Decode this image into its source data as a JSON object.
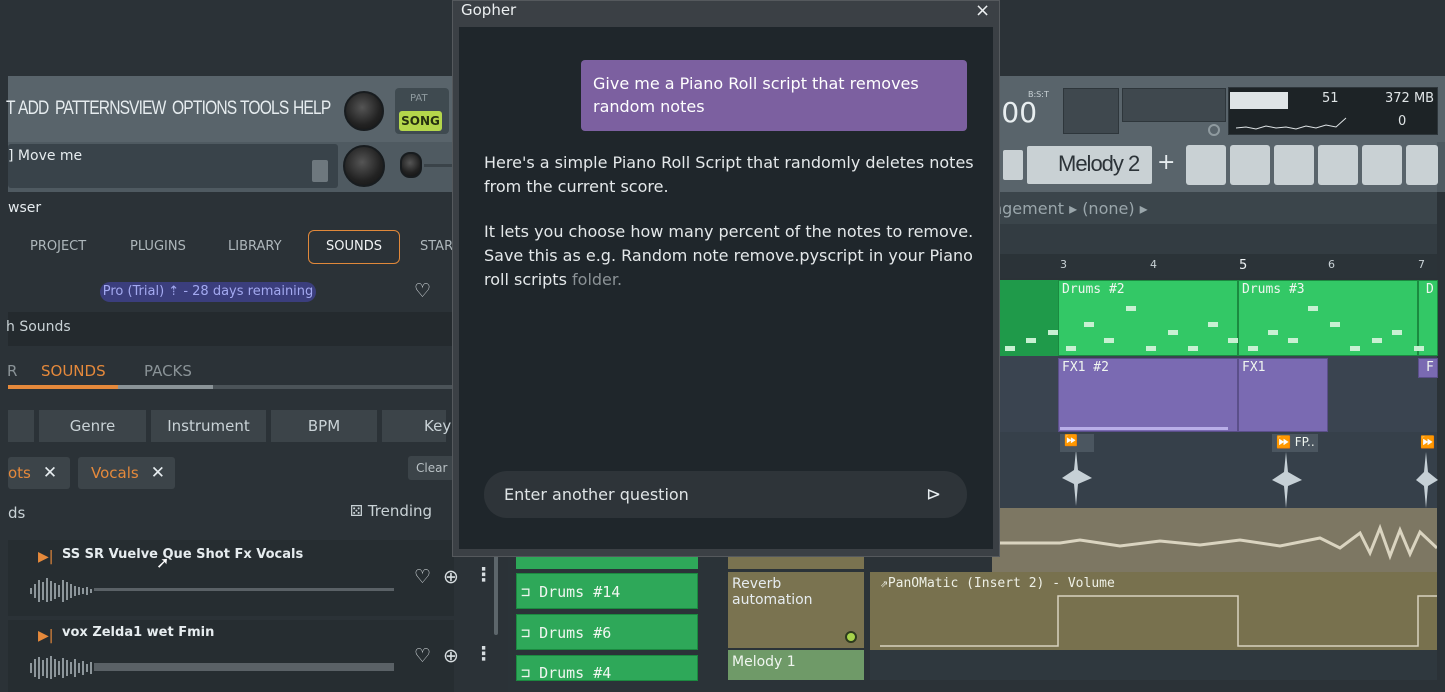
{
  "gopher": {
    "title": "Gopher",
    "close_glyph": "×",
    "user_message": "Give me a Piano Roll script that removes random notes",
    "bot_paragraph_1": "Here's a simple Piano Roll Script that randomly deletes notes from the current score.",
    "bot_paragraph_2_main": "It lets you choose how many percent of the notes to remove. Save this as e.g. Random note remove.pyscript in your Piano roll scripts",
    "bot_paragraph_2_faded": "folder.",
    "input_placeholder": "Enter another question",
    "send_glyph": "⊳"
  },
  "fl_menu": {
    "items": [
      "ADD",
      "PATTERNS",
      "VIEW",
      "OPTIONS",
      "TOOLS",
      "HELP"
    ],
    "pat_label": "PAT",
    "song_label": "SONG",
    "hint_text": "Move me",
    "browser_title": "wser"
  },
  "fl_right": {
    "time": ":00",
    "bst_label": "B:S:T",
    "cpu_value": "51",
    "memory": "372 MB",
    "polyphony": "0",
    "pattern_name": "Melody 2",
    "pattern_plus": "+",
    "playlist_path": "ngement ▸ (none) ▸",
    "ruler": [
      "3",
      "4",
      "5",
      "6",
      "7"
    ]
  },
  "playlist": {
    "clips": {
      "drums2": "Drums #2",
      "drums3": "Drums #3",
      "d_cut": "D",
      "fx1_2": "FX1 #2",
      "fx1": "FX1",
      "f_cut": "F",
      "fp": "FP..",
      "pan": "PanOMatic (Insert 2) - Volume"
    },
    "channel_clips": [
      "Drums #14",
      "Drums #6",
      "Drums #4"
    ],
    "reverb": "Reverb automation",
    "melody1": "Melody 1"
  },
  "browser": {
    "tabs": [
      "PROJECT",
      "PLUGINS",
      "LIBRARY",
      "SOUNDS",
      "STAR"
    ],
    "pro_pill": "Pro (Trial) ⇡ - 28 days remaining",
    "search_label": "h Sounds",
    "subtabs": {
      "left": "R",
      "sounds": "SOUNDS",
      "packs": "PACKS"
    },
    "filters": [
      "Genre",
      "Instrument",
      "BPM",
      "Key"
    ],
    "chips": [
      {
        "label": "ots"
      },
      {
        "label": "Vocals"
      }
    ],
    "chip_x": "✕",
    "clear": "Clear",
    "count_label": "ds",
    "sort": "Trending",
    "sounds": [
      {
        "title": "SS SR Vuelve Que Shot Fx Vocals"
      },
      {
        "title": "vox Zelda1 wet Fmin"
      }
    ]
  }
}
